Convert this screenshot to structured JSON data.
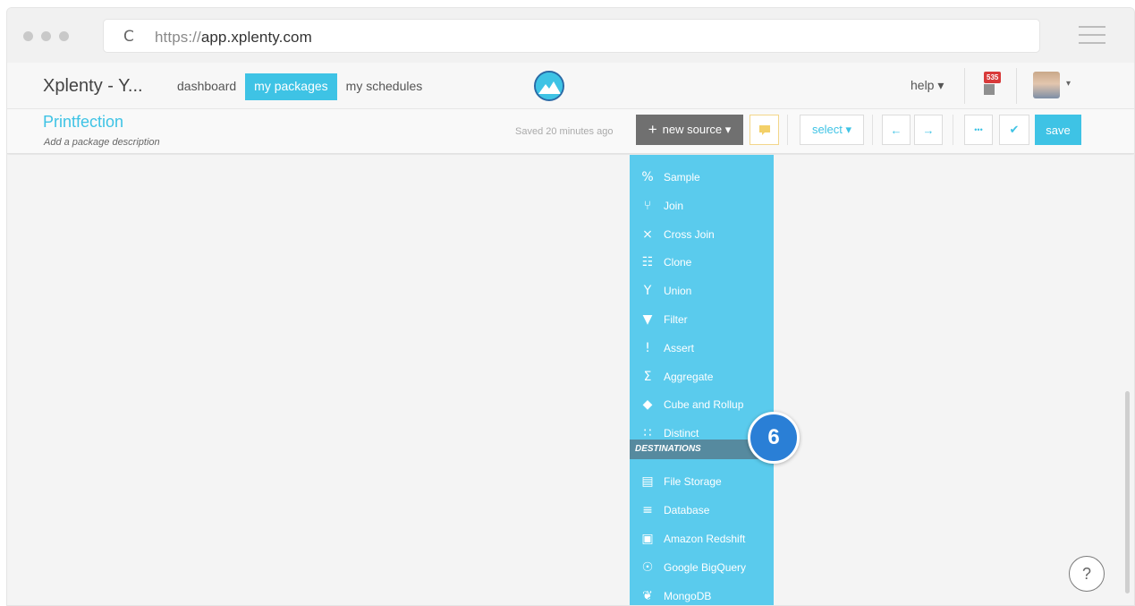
{
  "browser": {
    "url_proto": "https://",
    "url_host": "app.xplenty.com",
    "reload_icon": "C"
  },
  "appbar": {
    "brand": "Xplenty - Y...",
    "nav": [
      {
        "label": "dashboard",
        "active": false
      },
      {
        "label": "my packages",
        "active": true
      },
      {
        "label": "my schedules",
        "active": false
      }
    ],
    "help": "help ▾",
    "notifications_count": "535",
    "avatar_caret": "▾"
  },
  "package": {
    "title": "Printfection",
    "description_placeholder": "Add a package description",
    "saved_status": "Saved 20 minutes ago",
    "new_source_label": "new source ▾",
    "select_label": "select ▾",
    "save_label": "save",
    "undo_icon": "←",
    "redo_icon": "→",
    "more_icon": "•••",
    "check_icon": "✔"
  },
  "dropdown": {
    "transformations": [
      {
        "label": "Sample",
        "icon": "%",
        "icon_name": "sample-icon"
      },
      {
        "label": "Join",
        "icon": "⑂",
        "icon_name": "join-icon"
      },
      {
        "label": "Cross Join",
        "icon": "⨯",
        "icon_name": "cross-join-icon"
      },
      {
        "label": "Clone",
        "icon": "☷",
        "icon_name": "clone-icon"
      },
      {
        "label": "Union",
        "icon": "Y",
        "icon_name": "union-icon"
      },
      {
        "label": "Filter",
        "icon": "▼",
        "icon_name": "filter-icon"
      },
      {
        "label": "Assert",
        "icon": "!",
        "icon_name": "assert-icon"
      },
      {
        "label": "Aggregate",
        "icon": "Σ",
        "icon_name": "aggregate-icon"
      },
      {
        "label": "Cube and Rollup",
        "icon": "◆",
        "icon_name": "cube-icon"
      },
      {
        "label": "Distinct",
        "icon": "∷",
        "icon_name": "distinct-icon"
      }
    ],
    "destinations_header": "DESTINATIONS",
    "destinations": [
      {
        "label": "File Storage",
        "icon": "▤",
        "icon_name": "folder-icon"
      },
      {
        "label": "Database",
        "icon": "≡",
        "icon_name": "database-icon"
      },
      {
        "label": "Amazon Redshift",
        "icon": "▣",
        "icon_name": "redshift-icon"
      },
      {
        "label": "Google BigQuery",
        "icon": "☉",
        "icon_name": "bigquery-icon"
      },
      {
        "label": "MongoDB",
        "icon": "❦",
        "icon_name": "mongodb-icon"
      }
    ]
  },
  "step_marker": "6",
  "help_button": "?",
  "colors": {
    "accent": "#3ec3e5",
    "dropdown_bg": "#5acbed",
    "dropdown_header": "#568a9f",
    "step": "#2a7fd6"
  }
}
